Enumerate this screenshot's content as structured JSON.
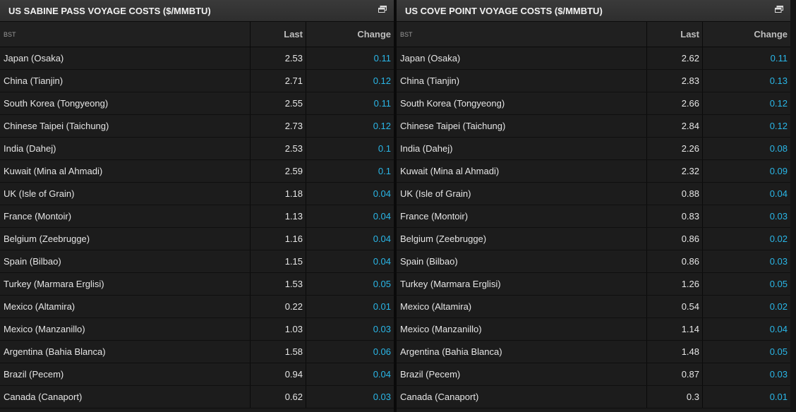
{
  "panels": [
    {
      "title": "US SABINE PASS VOYAGE COSTS ($/MMBTU)",
      "columns": {
        "region": "BST",
        "last": "Last",
        "change": "Change"
      },
      "rows": [
        {
          "name": "Japan (Osaka)",
          "last": "2.53",
          "change": "0.11"
        },
        {
          "name": "China (Tianjin)",
          "last": "2.71",
          "change": "0.12"
        },
        {
          "name": "South Korea (Tongyeong)",
          "last": "2.55",
          "change": "0.11"
        },
        {
          "name": "Chinese Taipei (Taichung)",
          "last": "2.73",
          "change": "0.12"
        },
        {
          "name": "India (Dahej)",
          "last": "2.53",
          "change": "0.1"
        },
        {
          "name": "Kuwait (Mina al Ahmadi)",
          "last": "2.59",
          "change": "0.1"
        },
        {
          "name": "UK (Isle of Grain)",
          "last": "1.18",
          "change": "0.04"
        },
        {
          "name": "France (Montoir)",
          "last": "1.13",
          "change": "0.04"
        },
        {
          "name": "Belgium (Zeebrugge)",
          "last": "1.16",
          "change": "0.04"
        },
        {
          "name": "Spain (Bilbao)",
          "last": "1.15",
          "change": "0.04"
        },
        {
          "name": "Turkey (Marmara Erglisi)",
          "last": "1.53",
          "change": "0.05"
        },
        {
          "name": "Mexico (Altamira)",
          "last": "0.22",
          "change": "0.01"
        },
        {
          "name": "Mexico (Manzanillo)",
          "last": "1.03",
          "change": "0.03"
        },
        {
          "name": "Argentina (Bahia Blanca)",
          "last": "1.58",
          "change": "0.06"
        },
        {
          "name": "Brazil (Pecem)",
          "last": "0.94",
          "change": "0.04"
        },
        {
          "name": "Canada (Canaport)",
          "last": "0.62",
          "change": "0.03"
        }
      ]
    },
    {
      "title": "US COVE POINT VOYAGE COSTS ($/MMBTU)",
      "columns": {
        "region": "BST",
        "last": "Last",
        "change": "Change"
      },
      "rows": [
        {
          "name": "Japan (Osaka)",
          "last": "2.62",
          "change": "0.11"
        },
        {
          "name": "China (Tianjin)",
          "last": "2.83",
          "change": "0.13"
        },
        {
          "name": "South Korea (Tongyeong)",
          "last": "2.66",
          "change": "0.12"
        },
        {
          "name": "Chinese Taipei (Taichung)",
          "last": "2.84",
          "change": "0.12"
        },
        {
          "name": "India (Dahej)",
          "last": "2.26",
          "change": "0.08"
        },
        {
          "name": "Kuwait (Mina al Ahmadi)",
          "last": "2.32",
          "change": "0.09"
        },
        {
          "name": "UK (Isle of Grain)",
          "last": "0.88",
          "change": "0.04"
        },
        {
          "name": "France (Montoir)",
          "last": "0.83",
          "change": "0.03"
        },
        {
          "name": "Belgium (Zeebrugge)",
          "last": "0.86",
          "change": "0.02"
        },
        {
          "name": "Spain (Bilbao)",
          "last": "0.86",
          "change": "0.03"
        },
        {
          "name": "Turkey (Marmara Erglisi)",
          "last": "1.26",
          "change": "0.05"
        },
        {
          "name": "Mexico (Altamira)",
          "last": "0.54",
          "change": "0.02"
        },
        {
          "name": "Mexico (Manzanillo)",
          "last": "1.14",
          "change": "0.04"
        },
        {
          "name": "Argentina (Bahia Blanca)",
          "last": "1.48",
          "change": "0.05"
        },
        {
          "name": "Brazil (Pecem)",
          "last": "0.87",
          "change": "0.03"
        },
        {
          "name": "Canada (Canaport)",
          "last": "0.3",
          "change": "0.01"
        }
      ]
    }
  ],
  "icons": {
    "popout": "popout-window-icon"
  },
  "colors": {
    "change_positive": "#2ab7e8",
    "header_bg": "#333333",
    "row_bg": "#1c1c1c"
  }
}
